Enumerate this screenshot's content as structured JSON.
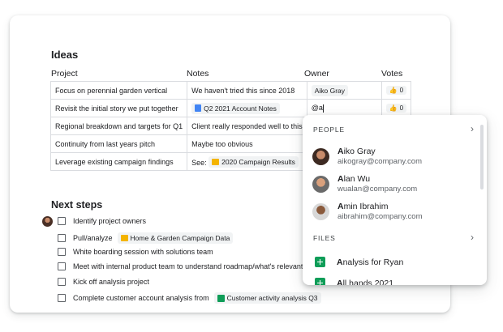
{
  "ideas": {
    "title": "Ideas",
    "headers": {
      "project": "Project",
      "notes": "Notes",
      "owner": "Owner",
      "votes": "Votes"
    },
    "rows": [
      {
        "project": "Focus on perennial garden vertical",
        "notes": "We haven't tried this since 2018",
        "owner": "Aiko Gray",
        "votes": "0"
      },
      {
        "project": "Revisit the initial story we put together",
        "notes": "Q2 2021 Account Notes",
        "owner": "@a",
        "votes": "0"
      },
      {
        "project": "Regional breakdown and targets for Q1",
        "notes": "Client really responded well to this",
        "owner": "",
        "votes": ""
      },
      {
        "project": "Continuity from last years pitch",
        "notes": "Maybe too obvious",
        "owner": "",
        "votes": ""
      },
      {
        "project": "Leverage existing campaign findings",
        "notes_prefix": "See:",
        "notes": "2020 Campaign Results",
        "owner": "",
        "votes": ""
      }
    ]
  },
  "next_steps": {
    "title": "Next steps",
    "tasks": [
      {
        "text": "Identify project owners"
      },
      {
        "text": "Pull/analyze",
        "chip": "Home & Garden Campaign Data"
      },
      {
        "text": "White boarding session with solutions team"
      },
      {
        "text": "Meet with internal product team to understand roadmap/what's relevant to"
      },
      {
        "text": "Kick off analysis project"
      },
      {
        "text": "Complete customer account analysis from",
        "chip": "Customer activity analysis Q3"
      }
    ]
  },
  "mention_popup": {
    "people_label": "PEOPLE",
    "people": [
      {
        "initial": "A",
        "rest": "iko Gray",
        "email": "aikogray@company.com"
      },
      {
        "initial": "A",
        "rest": "lan Wu",
        "email": "wualan@company.com"
      },
      {
        "initial": "A",
        "rest": "min Ibrahim",
        "email": "aibrahim@company.com"
      }
    ],
    "files_label": "FILES",
    "files": [
      {
        "initial": "A",
        "rest": "nalysis for Ryan"
      },
      {
        "initial": "A",
        "rest": "ll hands 2021"
      }
    ]
  },
  "icons": {
    "vote": "thumbs-up-icon",
    "expand": "chevron-right-icon"
  },
  "colors": {
    "sheets_green": "#0f9d58",
    "docs_blue": "#4285f4",
    "slides_yellow": "#f4b400"
  }
}
